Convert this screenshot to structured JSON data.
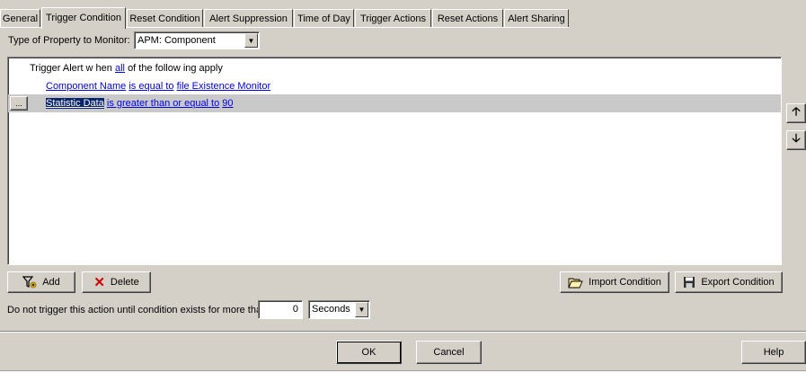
{
  "tabs": [
    {
      "label": "General"
    },
    {
      "label": "Trigger Condition"
    },
    {
      "label": "Reset Condition"
    },
    {
      "label": "Alert Suppression"
    },
    {
      "label": "Time of Day"
    },
    {
      "label": "Trigger Actions"
    },
    {
      "label": "Reset Actions"
    },
    {
      "label": "Alert Sharing"
    }
  ],
  "property": {
    "label": "Type of Property to Monitor:",
    "value": "APM: Component"
  },
  "condition": {
    "header_prefix": "Trigger Alert w hen",
    "header_link": "all",
    "header_suffix": "of the follow ing apply",
    "rows": [
      {
        "field": "Component Name",
        "operator": "is equal to",
        "value": "file Existence Monitor"
      },
      {
        "field": "Statistic Data",
        "operator": "is greater than or equal to",
        "value": "90",
        "row_button": "..."
      }
    ]
  },
  "buttons": {
    "add": "Add",
    "delete": "Delete",
    "import": "Import Condition",
    "export": "Export Condition",
    "ok": "OK",
    "cancel": "Cancel",
    "help": "Help"
  },
  "delay": {
    "label": "Do not trigger this action until condition exists for more than",
    "value": "0",
    "unit": "Seconds"
  },
  "icons": [
    "add-condition-icon",
    "delete-x-icon",
    "folder-open-icon",
    "floppy-disk-icon",
    "arrow-up-icon",
    "arrow-down-icon",
    "chevron-down-icon"
  ],
  "colors": {
    "selection": "#0a246a",
    "link": "#0000ee",
    "selected_row": "#c9c9c9",
    "delete_x": "#cc0000"
  }
}
